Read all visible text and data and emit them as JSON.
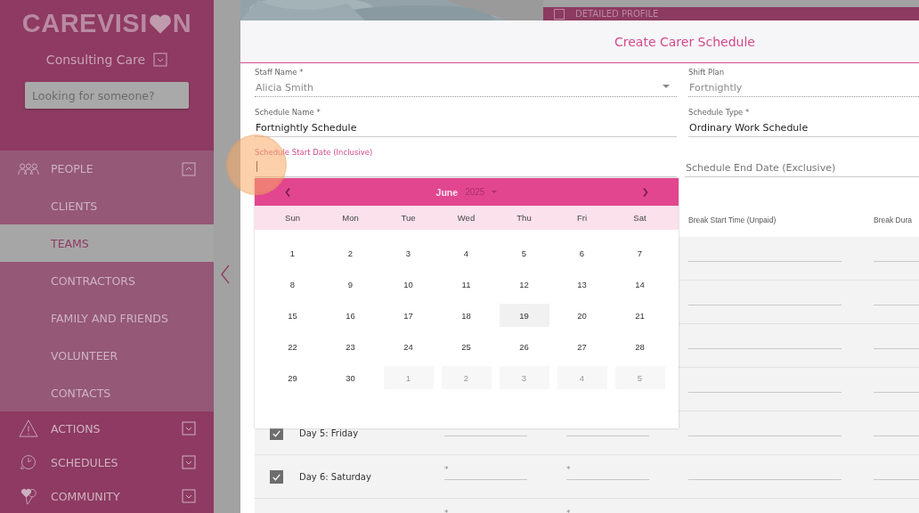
{
  "sidebar": {
    "logo": {
      "before": "CAREVISI",
      "after": "N"
    },
    "organization": "Consulting Care",
    "search": {
      "placeholder": "Looking for someone?"
    },
    "sections": [
      {
        "label": "PEOPLE",
        "expanded": true,
        "children": [
          {
            "label": "CLIENTS",
            "selected": false
          },
          {
            "label": "TEAMS",
            "selected": true
          },
          {
            "label": "CONTRACTORS",
            "selected": false
          },
          {
            "label": "FAMILY AND FRIENDS",
            "selected": false
          },
          {
            "label": "VOLUNTEER",
            "selected": false
          },
          {
            "label": "CONTACTS",
            "selected": false
          }
        ]
      },
      {
        "label": "ACTIONS",
        "expanded": false
      },
      {
        "label": "SCHEDULES",
        "expanded": false
      },
      {
        "label": "COMMUNITY",
        "expanded": false
      }
    ]
  },
  "background": {
    "profile_tab": "DETAILED PROFILE"
  },
  "dialog": {
    "title": "Create Carer Schedule",
    "fields": [
      {
        "kind": "select",
        "label": "Staff Name *",
        "value": "Alicia Smith",
        "disabled": true,
        "focused": false
      },
      {
        "kind": "text",
        "label": "Shift Plan",
        "value": "Fortnightly",
        "disabled": true,
        "focused": false
      },
      {
        "kind": "text",
        "label": "Schedule Name *",
        "value": "Fortnightly Schedule",
        "disabled": false,
        "focused": false
      },
      {
        "kind": "text",
        "label": "Schedule Type *",
        "value": "Ordinary Work Schedule",
        "disabled": false,
        "focused": false
      },
      {
        "kind": "date",
        "label": "Schedule Start Date (Inclusive)",
        "disabled": false,
        "focused": true
      },
      {
        "kind": "date",
        "placeholder": "Schedule End Date (Exclusive)",
        "disabled": false,
        "focused": false
      }
    ],
    "table": {
      "columns": [
        "Break Start Time (Unpaid)",
        "Break Dura"
      ],
      "rows": [
        {},
        {},
        {},
        {},
        {
          "checked": true,
          "label": "Day 5: Friday"
        },
        {
          "checked": true,
          "label": "Day 6: Saturday",
          "start_mark": "*",
          "end_mark": "*"
        },
        {
          "start_mark": "*",
          "end_mark": "*"
        }
      ]
    },
    "calendar": {
      "month": "June",
      "year": "2025",
      "weekdays": [
        "Sun",
        "Mon",
        "Tue",
        "Wed",
        "Thu",
        "Fri",
        "Sat"
      ],
      "weeks": [
        [
          {
            "day": "1",
            "today": false,
            "outside": false
          },
          {
            "day": "2",
            "today": false,
            "outside": false
          },
          {
            "day": "3",
            "today": false,
            "outside": false
          },
          {
            "day": "4",
            "today": false,
            "outside": false
          },
          {
            "day": "5",
            "today": false,
            "outside": false
          },
          {
            "day": "6",
            "today": false,
            "outside": false
          },
          {
            "day": "7",
            "today": false,
            "outside": false
          }
        ],
        [
          {
            "day": "8",
            "today": false,
            "outside": false
          },
          {
            "day": "9",
            "today": false,
            "outside": false
          },
          {
            "day": "10",
            "today": false,
            "outside": false
          },
          {
            "day": "11",
            "today": false,
            "outside": false
          },
          {
            "day": "12",
            "today": false,
            "outside": false
          },
          {
            "day": "13",
            "today": false,
            "outside": false
          },
          {
            "day": "14",
            "today": false,
            "outside": false
          }
        ],
        [
          {
            "day": "15",
            "today": false,
            "outside": false
          },
          {
            "day": "16",
            "today": false,
            "outside": false
          },
          {
            "day": "17",
            "today": false,
            "outside": false
          },
          {
            "day": "18",
            "today": false,
            "outside": false
          },
          {
            "day": "19",
            "today": true,
            "outside": false
          },
          {
            "day": "20",
            "today": false,
            "outside": false
          },
          {
            "day": "21",
            "today": false,
            "outside": false
          }
        ],
        [
          {
            "day": "22",
            "today": false,
            "outside": false
          },
          {
            "day": "23",
            "today": false,
            "outside": false
          },
          {
            "day": "24",
            "today": false,
            "outside": false
          },
          {
            "day": "25",
            "today": false,
            "outside": false
          },
          {
            "day": "26",
            "today": false,
            "outside": false
          },
          {
            "day": "27",
            "today": false,
            "outside": false
          },
          {
            "day": "28",
            "today": false,
            "outside": false
          }
        ],
        [
          {
            "day": "29",
            "today": false,
            "outside": false
          },
          {
            "day": "30",
            "today": false,
            "outside": false
          },
          {
            "day": "1",
            "today": false,
            "outside": true
          },
          {
            "day": "2",
            "today": false,
            "outside": true
          },
          {
            "day": "3",
            "today": false,
            "outside": true
          },
          {
            "day": "4",
            "today": false,
            "outside": true
          },
          {
            "day": "5",
            "today": false,
            "outside": true
          }
        ]
      ]
    }
  }
}
